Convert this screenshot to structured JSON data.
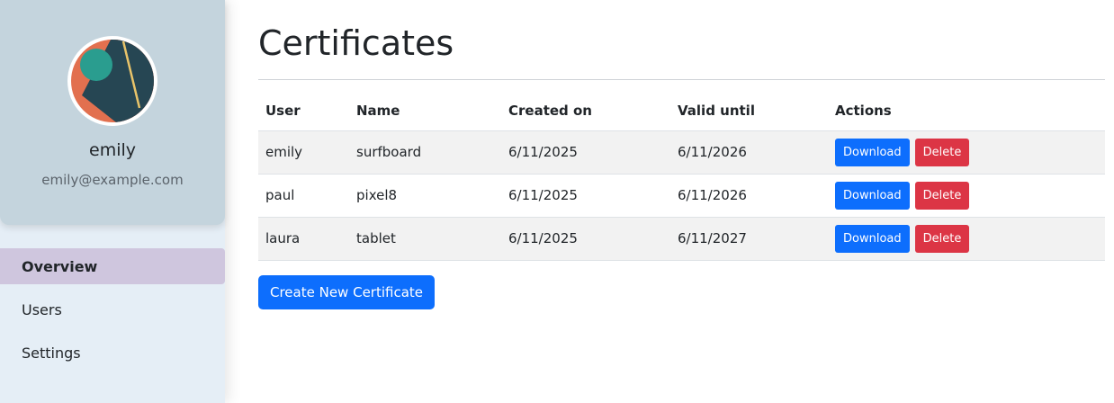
{
  "profile": {
    "username": "emily",
    "email": "emily@example.com"
  },
  "nav": {
    "items": [
      {
        "label": "Overview"
      },
      {
        "label": "Users"
      },
      {
        "label": "Settings"
      }
    ],
    "active": "Overview"
  },
  "main": {
    "title": "Certificates",
    "create_label": "Create New Certificate"
  },
  "table": {
    "columns": [
      "User",
      "Name",
      "Created on",
      "Valid until",
      "Actions"
    ],
    "rows": [
      {
        "user": "emily",
        "name": "surfboard",
        "created": "6/11/2025",
        "valid": "6/11/2026",
        "download": "Download",
        "delete": "Delete"
      },
      {
        "user": "paul",
        "name": "pixel8",
        "created": "6/11/2025",
        "valid": "6/11/2026",
        "download": "Download",
        "delete": "Delete"
      },
      {
        "user": "laura",
        "name": "tablet",
        "created": "6/11/2025",
        "valid": "6/11/2027",
        "download": "Download",
        "delete": "Delete"
      }
    ]
  },
  "colors": {
    "primary": "#0d6efd",
    "danger": "#dc3545",
    "sidebar_bg": "#e5eef6",
    "profile_bg": "#c4d4dd",
    "nav_active_bg": "#cfc6de"
  }
}
